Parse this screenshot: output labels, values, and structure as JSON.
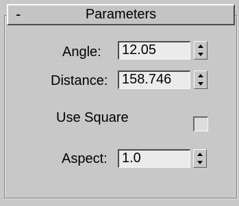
{
  "rollout": {
    "toggle_symbol": "-",
    "title": "Parameters"
  },
  "angle": {
    "label": "Angle:",
    "value": "12.05"
  },
  "distance": {
    "label": "Distance:",
    "value": "158.746"
  },
  "use_square": {
    "label": "Use Square",
    "checked": false
  },
  "aspect": {
    "label": "Aspect:",
    "value": "1.0"
  },
  "icons": {
    "spinner": "up-down-arrows-icon",
    "collapse": "minus-icon"
  }
}
